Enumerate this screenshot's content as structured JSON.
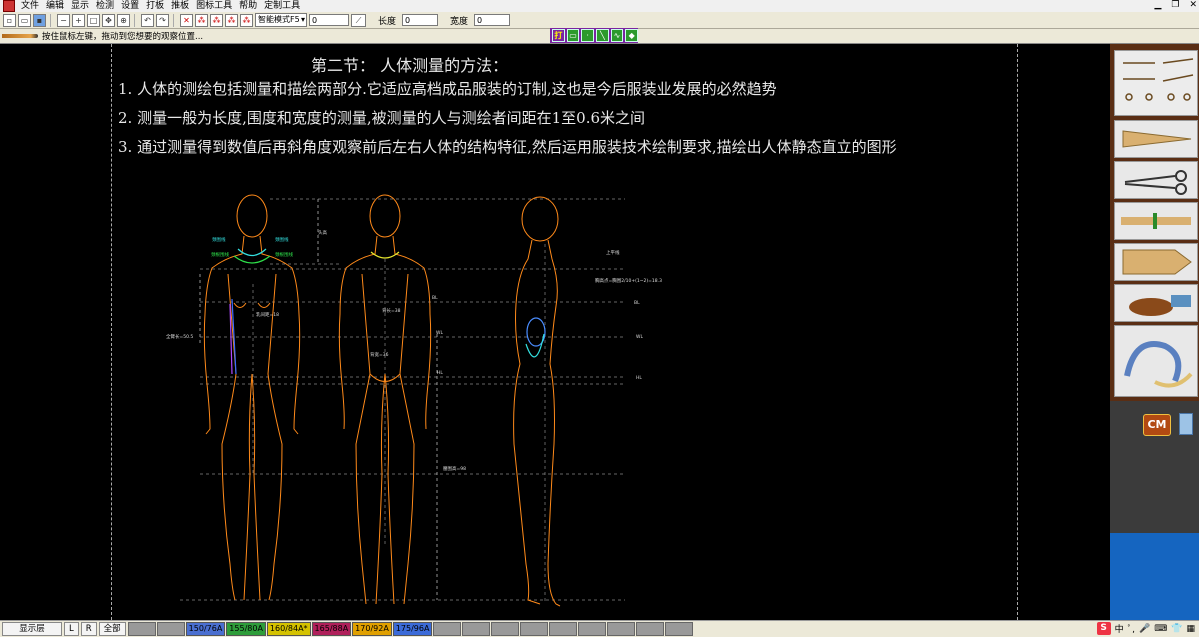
{
  "menu": [
    "文件",
    "编辑",
    "显示",
    "检测",
    "设置",
    "打板",
    "推板",
    "图标工具",
    "帮助",
    "定制工具"
  ],
  "toolbar": {
    "mode": "智能模式F5",
    "value1": "0",
    "length_label": "长度",
    "length_value": "0",
    "width_label": "宽度",
    "width_value": "0"
  },
  "status": {
    "hint": "按住鼠标左键，拖动到您想要的观察位置..."
  },
  "tool_strip": {
    "first": "打"
  },
  "document": {
    "title": "第二节：  人体测量的方法：",
    "lines": [
      "1.   人体的测绘包括测量和描绘两部分.它适应高档成品服装的订制,这也是今后服装业发展的必然趋势",
      "2.   测量一般为长度,围度和宽度的测量,被测量的人与测绘者间距在1至0.6米之间",
      "3.   通过测量得到数值后再斜角度观察前后左右人体的结构特征,然后运用服装技术绘制要求,描绘出人体静态直立的图形"
    ]
  },
  "figure_labels": {
    "head": "头高",
    "neck_left": "颈围线",
    "neck_right": "颈围线",
    "neck_base_left": "颈根围线",
    "neck_base_right": "颈根围线",
    "full_length": "全臂长=50.5",
    "back_length": "背长=38",
    "upper_level": "上平线",
    "bust_line": "胸高点=胸围2/10+(1~2)=18.3",
    "bl": "BL",
    "wl": "WL",
    "hl": "HL",
    "bl_left": "BL",
    "wl_left": "WL",
    "hl_left": "HL",
    "waist_height": "腰围高=98",
    "nipple": "乳间距=18",
    "cross_back": "背宽=36"
  },
  "sidepanel": {
    "cm_label": "CM"
  },
  "bottom": {
    "layer_button": "显示层",
    "l_button": "L",
    "r_button": "R",
    "all_button": "全部",
    "sizes": [
      {
        "label": "150/76A",
        "color": "#4a6fd0"
      },
      {
        "label": "155/80A",
        "color": "#2e9d3a"
      },
      {
        "label": "160/84A*",
        "color": "#d4c200"
      },
      {
        "label": "165/88A",
        "color": "#b0205a"
      },
      {
        "label": "170/92A",
        "color": "#e0a000"
      },
      {
        "label": "175/96A",
        "color": "#3c6bd8"
      }
    ],
    "ime": "中"
  }
}
